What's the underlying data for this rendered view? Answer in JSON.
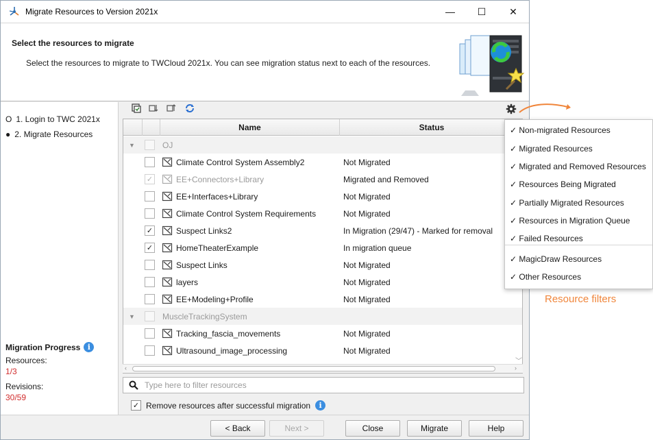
{
  "window": {
    "title": "Migrate Resources to Version 2021x",
    "minimize": "—",
    "maximize": "☐",
    "close": "✕"
  },
  "header": {
    "title": "Select the resources to migrate",
    "description": "Select the resources to migrate to TWCloud 2021x. You can see migration status next to each of the resources."
  },
  "steps": [
    {
      "marker": "O",
      "label": "1. Login to TWC 2021x",
      "active": false
    },
    {
      "marker": "●",
      "label": "2. Migrate Resources",
      "active": true
    }
  ],
  "progress": {
    "title": "Migration Progress",
    "resources_label": "Resources:",
    "resources_value": "1/3",
    "revisions_label": "Revisions:",
    "revisions_value": "30/59"
  },
  "toolbar": {
    "icons": [
      "select-all-icon",
      "expand-all-icon",
      "collapse-all-icon",
      "refresh-icon"
    ]
  },
  "table": {
    "columns": [
      "Name",
      "Status"
    ],
    "rows": [
      {
        "type": "group",
        "name": "OJ",
        "status": ""
      },
      {
        "type": "item",
        "checked": false,
        "disabled": false,
        "name": "Climate Control System Assembly2",
        "status": "Not Migrated"
      },
      {
        "type": "item",
        "checked": true,
        "disabled": true,
        "name": "EE+Connectors+Library",
        "status": "Migrated and Removed"
      },
      {
        "type": "item",
        "checked": false,
        "disabled": false,
        "name": "EE+Interfaces+Library",
        "status": "Not Migrated"
      },
      {
        "type": "item",
        "checked": false,
        "disabled": false,
        "name": "Climate Control System Requirements",
        "status": "Not Migrated"
      },
      {
        "type": "item",
        "checked": true,
        "disabled": false,
        "name": "Suspect Links2",
        "status": "In Migration (29/47) - Marked for removal"
      },
      {
        "type": "item",
        "checked": true,
        "disabled": false,
        "name": "HomeTheaterExample",
        "status": "In migration queue"
      },
      {
        "type": "item",
        "checked": false,
        "disabled": false,
        "name": "Suspect Links",
        "status": "Not Migrated"
      },
      {
        "type": "item",
        "checked": false,
        "disabled": false,
        "name": "layers",
        "status": "Not Migrated"
      },
      {
        "type": "item",
        "checked": false,
        "disabled": false,
        "name": "EE+Modeling+Profile",
        "status": "Not Migrated"
      },
      {
        "type": "group",
        "name": "MuscleTrackingSystem",
        "status": ""
      },
      {
        "type": "item",
        "checked": false,
        "disabled": false,
        "name": "Tracking_fascia_movements",
        "status": "Not Migrated"
      },
      {
        "type": "item",
        "checked": false,
        "disabled": false,
        "name": "Ultrasound_image_processing",
        "status": "Not Migrated"
      }
    ]
  },
  "filter": {
    "placeholder": "Type here to filter resources",
    "value": ""
  },
  "remove_option": {
    "label": "Remove resources after successful migration",
    "checked": true
  },
  "buttons": {
    "back": "< Back",
    "next": "Next >",
    "close": "Close",
    "migrate": "Migrate",
    "help": "Help"
  },
  "filter_menu": {
    "items": [
      "✓ Non-migrated Resources",
      "✓ Migrated Resources",
      "✓ Migrated and Removed Resources",
      "✓ Resources Being Migrated",
      "✓ Partially Migrated Resources",
      "✓ Resources in Migration Queue",
      "✓ Failed Resources",
      "✓ MagicDraw Resources",
      "✓ Other Resources"
    ]
  },
  "callout": {
    "label": "Resource filters",
    "color": "#f0853a"
  },
  "colors": {
    "error_value": "#d12c2c",
    "info": "#3b8ee0"
  }
}
